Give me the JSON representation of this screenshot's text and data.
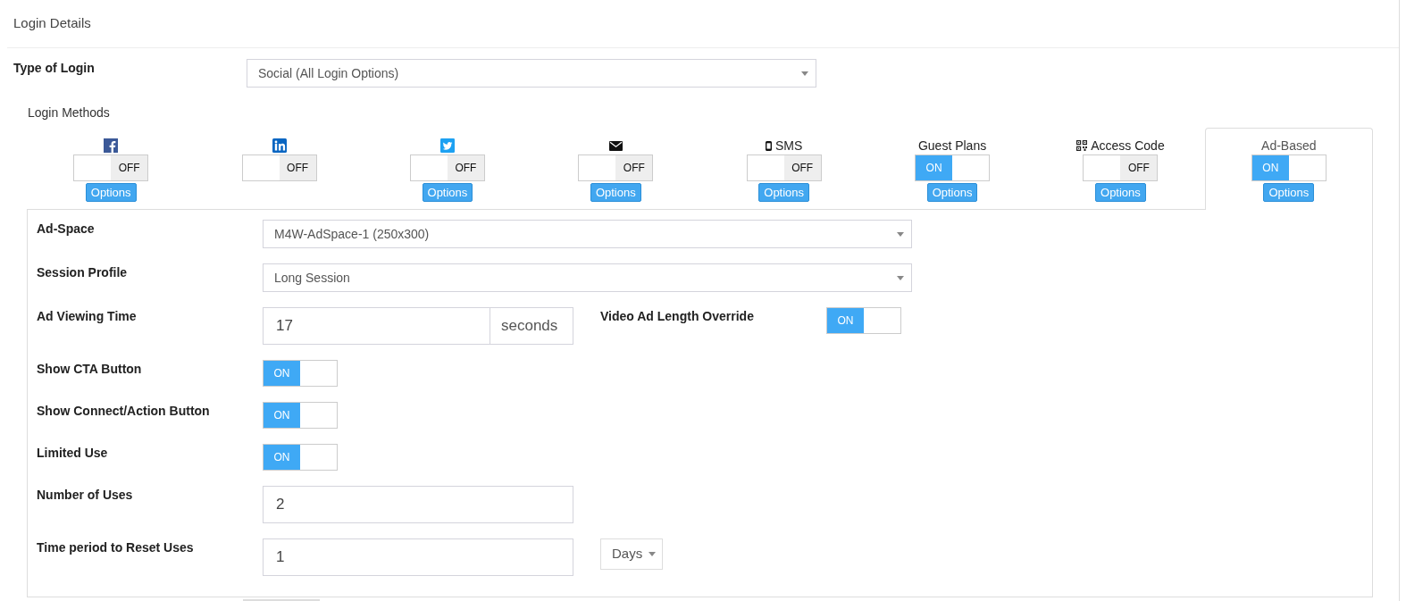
{
  "header": {
    "title": "Login Details"
  },
  "login_type": {
    "label": "Type of Login",
    "value": "Social (All Login Options)"
  },
  "login_methods": {
    "title": "Login Methods",
    "items": [
      {
        "kind": "facebook",
        "selected": false,
        "on": false,
        "toggle": "OFF",
        "options": "Options"
      },
      {
        "kind": "linkedin",
        "selected": false,
        "on": false,
        "toggle": "OFF"
      },
      {
        "kind": "twitter",
        "selected": false,
        "on": false,
        "toggle": "OFF",
        "options": "Options"
      },
      {
        "kind": "envelope",
        "selected": false,
        "on": false,
        "toggle": "OFF",
        "options": "Options"
      },
      {
        "kind": "phone",
        "label": "SMS",
        "selected": false,
        "on": false,
        "toggle": "OFF",
        "options": "Options"
      },
      {
        "kind": "text",
        "label": "Guest Plans",
        "selected": false,
        "on": true,
        "toggle": "ON",
        "options": "Options"
      },
      {
        "kind": "qrcode",
        "label": "Access Code",
        "selected": false,
        "on": false,
        "toggle": "OFF",
        "options": "Options"
      },
      {
        "kind": "text",
        "label": "Ad-Based",
        "selected": true,
        "on": true,
        "toggle": "ON",
        "options": "Options"
      }
    ]
  },
  "ad_settings": {
    "rows": [
      {
        "kind": "dropdown",
        "label": "Ad-Space",
        "value": "M4W-AdSpace-1 (250x300)"
      },
      {
        "kind": "dropdown",
        "label": "Session Profile",
        "value": "Long Session"
      },
      {
        "kind": "input",
        "label": "Ad Viewing Time",
        "value": "17",
        "unit": "seconds",
        "side_toggle": {
          "label": "Video Ad Length Override",
          "on": true,
          "toggle": "ON"
        }
      },
      {
        "kind": "toggle",
        "label": "Show CTA Button",
        "on": true,
        "toggle": "ON"
      },
      {
        "kind": "toggle",
        "label": "Show Connect/Action Button",
        "on": true,
        "toggle": "ON"
      },
      {
        "kind": "toggle",
        "label": "Limited Use",
        "on": true,
        "toggle": "ON"
      },
      {
        "kind": "input",
        "label": "Number of Uses",
        "value": "2"
      },
      {
        "kind": "input",
        "label": "Time period to Reset Uses",
        "value": "1",
        "period_dropdown": "Days"
      }
    ]
  }
}
